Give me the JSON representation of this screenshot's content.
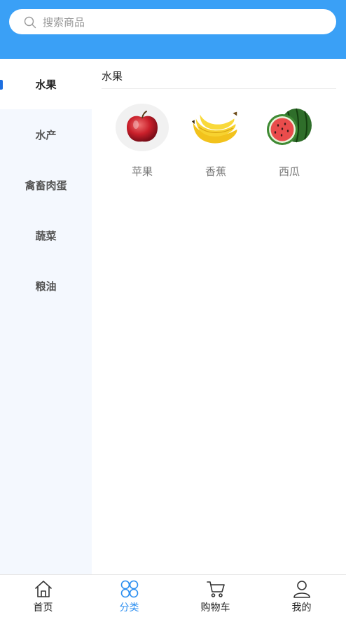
{
  "search": {
    "placeholder": "搜索商品"
  },
  "sidebar": {
    "items": [
      {
        "label": "水果",
        "active": true
      },
      {
        "label": "水产"
      },
      {
        "label": "禽畜肉蛋"
      },
      {
        "label": "蔬菜"
      },
      {
        "label": "粮油"
      }
    ]
  },
  "content": {
    "section_title": "水果",
    "products": [
      {
        "name": "苹果",
        "icon": "apple-image"
      },
      {
        "name": "香蕉",
        "icon": "banana-image"
      },
      {
        "name": "西瓜",
        "icon": "watermelon-image"
      }
    ]
  },
  "tabbar": {
    "tabs": [
      {
        "label": "首页",
        "icon": "home-icon"
      },
      {
        "label": "分类",
        "icon": "category-icon",
        "active": true
      },
      {
        "label": "购物车",
        "icon": "cart-icon"
      },
      {
        "label": "我的",
        "icon": "user-icon"
      }
    ]
  },
  "colors": {
    "header": "#3aa0f6",
    "accent": "#2b8ef0",
    "sidebar_bg": "#f4f8fe"
  }
}
